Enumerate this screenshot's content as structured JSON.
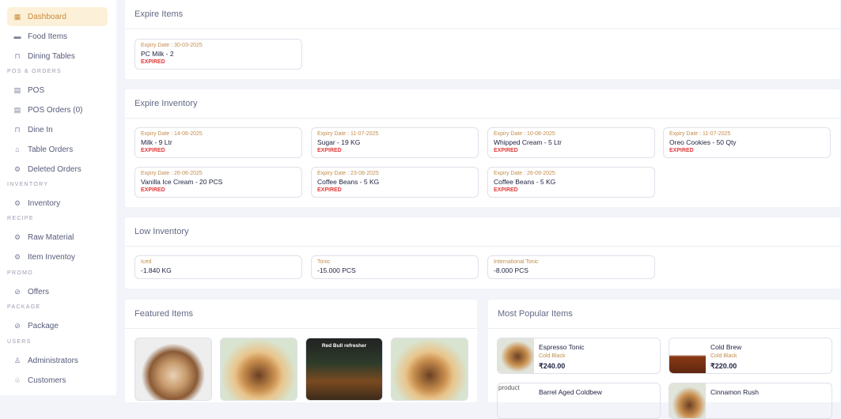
{
  "sidebar": {
    "items": [
      {
        "label": "Dashboard",
        "icon": "dashboard-icon"
      },
      {
        "label": "Food Items",
        "icon": "food-icon"
      },
      {
        "label": "Dining Tables",
        "icon": "table-icon"
      },
      {
        "label": "POS",
        "icon": "pos-icon"
      },
      {
        "label": "POS Orders (0)",
        "icon": "orders-icon"
      },
      {
        "label": "Dine In",
        "icon": "table-icon"
      },
      {
        "label": "Table Orders",
        "icon": "bell-icon"
      },
      {
        "label": "Deleted Orders",
        "icon": "gear-icon"
      },
      {
        "label": "Inventory",
        "icon": "gear-icon"
      },
      {
        "label": "Raw Material",
        "icon": "gear-icon"
      },
      {
        "label": "Item Inventoy",
        "icon": "gear-icon"
      },
      {
        "label": "Offers",
        "icon": "offer-icon"
      },
      {
        "label": "Package",
        "icon": "package-icon"
      },
      {
        "label": "Administrators",
        "icon": "user-icon"
      },
      {
        "label": "Customers",
        "icon": "users-icon"
      }
    ],
    "sections": [
      "POS & ORDERS",
      "INVENTORY",
      "RECIPE",
      "PROMO",
      "PACKAGE",
      "USERS"
    ]
  },
  "expire_items": {
    "title": "Expire Items",
    "items": [
      {
        "date": "Expiry Date : 30-03-2025",
        "name": "PC Milk - 2",
        "status": "EXPIRED"
      }
    ]
  },
  "expire_inventory": {
    "title": "Expire Inventory",
    "items": [
      {
        "date": "Expiry Date : 14-06-2025",
        "name": "Milk - 9 Ltr",
        "status": "EXPIRED"
      },
      {
        "date": "Expiry Date : 11-07-2025",
        "name": "Sugar - 19 KG",
        "status": "EXPIRED"
      },
      {
        "date": "Expiry Date : 10-08-2025",
        "name": "Whipped Cream - 5 Ltr",
        "status": "EXPIRED"
      },
      {
        "date": "Expiry Date : 11-07-2025",
        "name": "Oreo Cookies - 50 Qty",
        "status": "EXPIRED"
      },
      {
        "date": "Expiry Date : 26-06-2025",
        "name": "Vanilla Ice Cream - 20 PCS",
        "status": "EXPIRED"
      },
      {
        "date": "Expiry Date : 23-08-2025",
        "name": "Coffee Beans - 5 KG",
        "status": "EXPIRED"
      },
      {
        "date": "Expiry Date : 26-09-2025",
        "name": "Coffee Beans - 5 KG",
        "status": "EXPIRED"
      }
    ]
  },
  "low_inventory": {
    "title": "Low Inventory",
    "items": [
      {
        "name": "Iced",
        "qty": "-1.840 KG"
      },
      {
        "name": "Tonic",
        "qty": "-15.000 PCS"
      },
      {
        "name": "International Tonic",
        "qty": "-8.000 PCS"
      }
    ]
  },
  "featured": {
    "title": "Featured Items",
    "image_caption": "Red Bull refresher"
  },
  "popular": {
    "title": "Most Popular Items",
    "items": [
      {
        "name": "Espresso Tonic",
        "category": "Cold Black",
        "price": "₹240.00"
      },
      {
        "name": "Cold Brew",
        "category": "Cold Black",
        "price": "₹220.00"
      },
      {
        "name": "Barrel Aged Coldbew",
        "alt": "product"
      },
      {
        "name": "Cinnamon Rush"
      }
    ]
  }
}
